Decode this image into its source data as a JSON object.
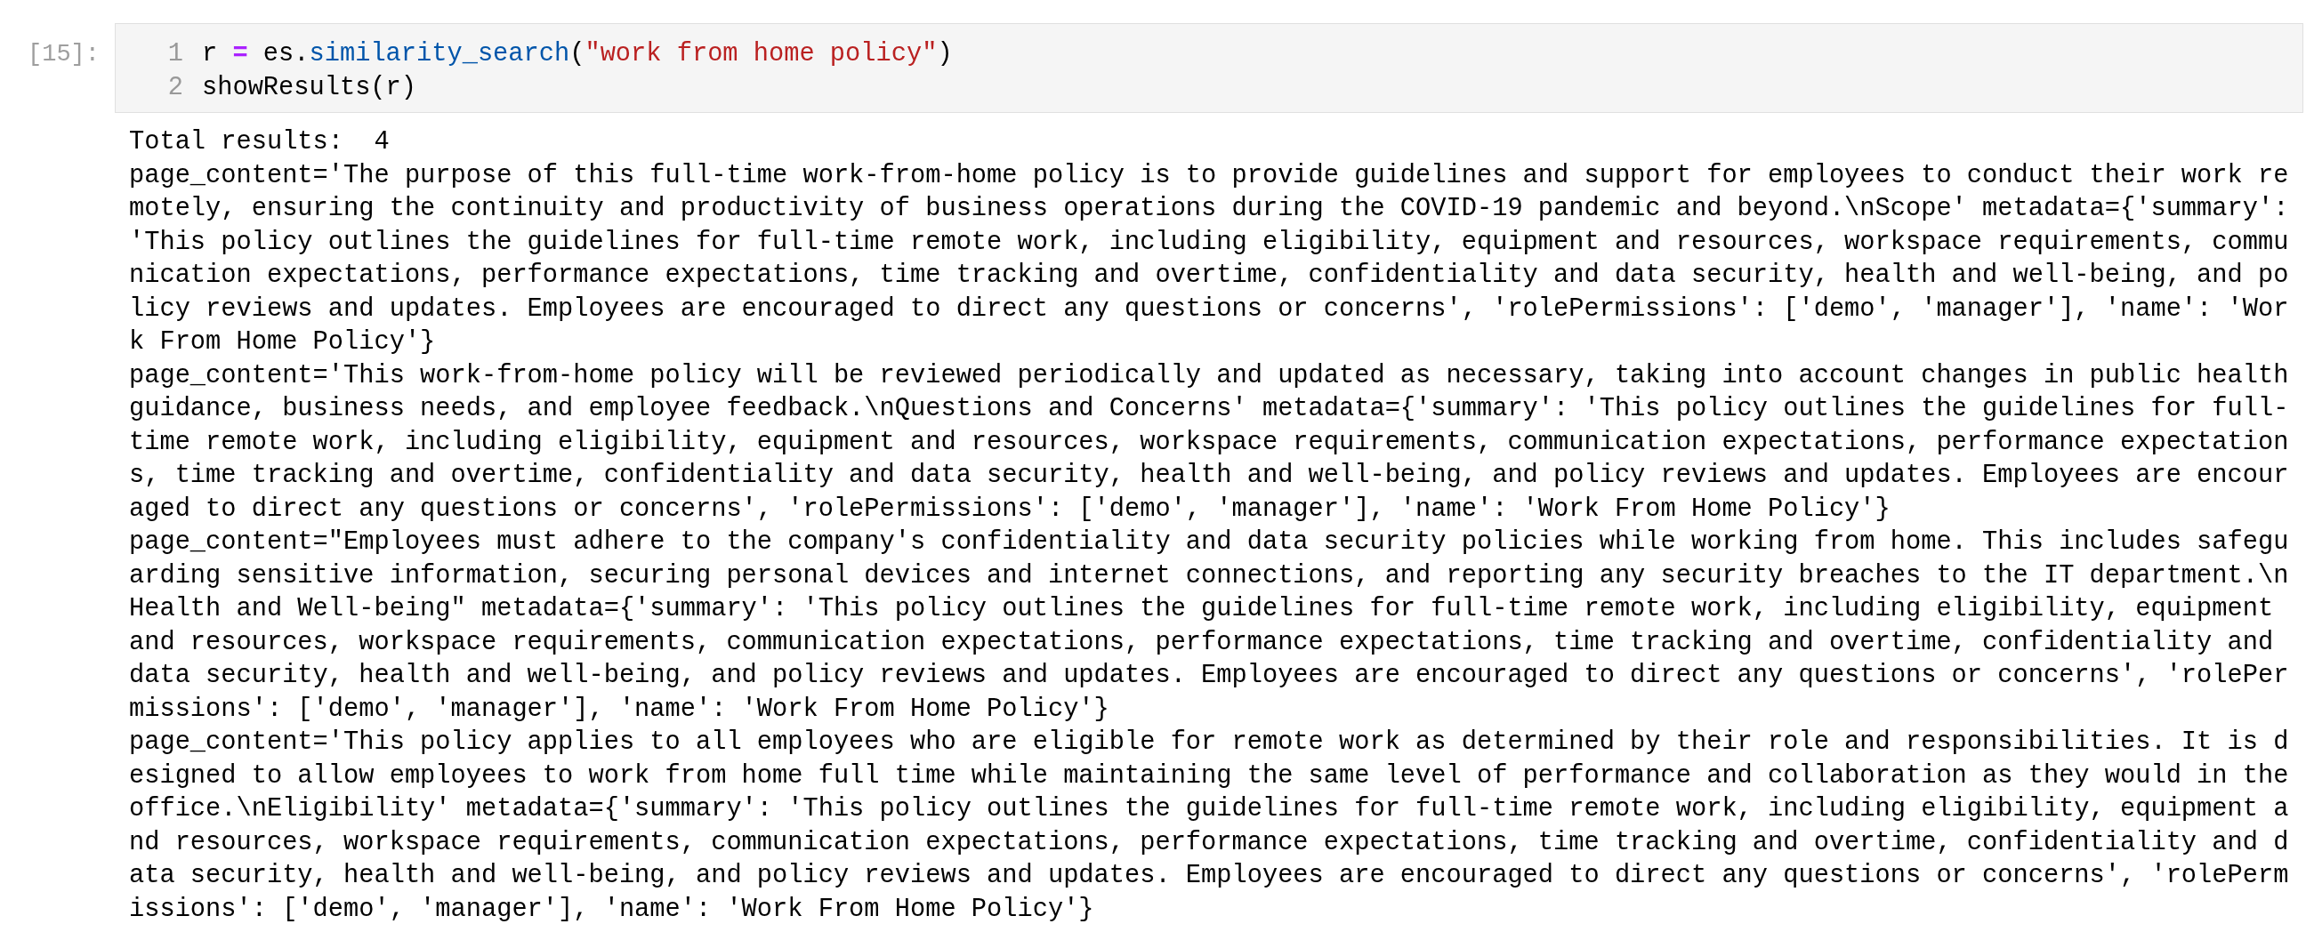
{
  "cell": {
    "prompt": "[15]:",
    "code": [
      {
        "number": "1",
        "tokens": [
          {
            "text": "r ",
            "kind": "plain"
          },
          {
            "text": "=",
            "kind": "operator"
          },
          {
            "text": " es.",
            "kind": "plain"
          },
          {
            "text": "similarity_search",
            "kind": "property"
          },
          {
            "text": "(",
            "kind": "plain"
          },
          {
            "text": "\"work from home policy\"",
            "kind": "string"
          },
          {
            "text": ")",
            "kind": "plain"
          }
        ]
      },
      {
        "number": "2",
        "tokens": [
          {
            "text": "showResults(r)",
            "kind": "plain"
          }
        ]
      }
    ]
  },
  "output": {
    "lines": [
      "Total results:  4",
      "page_content='The purpose of this full-time work-from-home policy is to provide guidelines and support for employees to conduct their work remotely, ensuring the continuity and productivity of business operations during the COVID-19 pandemic and beyond.\\nScope' metadata={'summary': 'This policy outlines the guidelines for full-time remote work, including eligibility, equipment and resources, workspace requirements, communication expectations, performance expectations, time tracking and overtime, confidentiality and data security, health and well-being, and policy reviews and updates. Employees are encouraged to direct any questions or concerns', 'rolePermissions': ['demo', 'manager'], 'name': 'Work From Home Policy'}",
      "page_content='This work-from-home policy will be reviewed periodically and updated as necessary, taking into account changes in public health guidance, business needs, and employee feedback.\\nQuestions and Concerns' metadata={'summary': 'This policy outlines the guidelines for full-time remote work, including eligibility, equipment and resources, workspace requirements, communication expectations, performance expectations, time tracking and overtime, confidentiality and data security, health and well-being, and policy reviews and updates. Employees are encouraged to direct any questions or concerns', 'rolePermissions': ['demo', 'manager'], 'name': 'Work From Home Policy'}",
      "page_content=\"Employees must adhere to the company's confidentiality and data security policies while working from home. This includes safeguarding sensitive information, securing personal devices and internet connections, and reporting any security breaches to the IT department.\\nHealth and Well-being\" metadata={'summary': 'This policy outlines the guidelines for full-time remote work, including eligibility, equipment and resources, workspace requirements, communication expectations, performance expectations, time tracking and overtime, confidentiality and data security, health and well-being, and policy reviews and updates. Employees are encouraged to direct any questions or concerns', 'rolePermissions': ['demo', 'manager'], 'name': 'Work From Home Policy'}",
      "page_content='This policy applies to all employees who are eligible for remote work as determined by their role and responsibilities. It is designed to allow employees to work from home full time while maintaining the same level of performance and collaboration as they would in the office.\\nEligibility' metadata={'summary': 'This policy outlines the guidelines for full-time remote work, including eligibility, equipment and resources, workspace requirements, communication expectations, performance expectations, time tracking and overtime, confidentiality and data security, health and well-being, and policy reviews and updates. Employees are encouraged to direct any questions or concerns', 'rolePermissions': ['demo', 'manager'], 'name': 'Work From Home Policy'}"
    ]
  }
}
